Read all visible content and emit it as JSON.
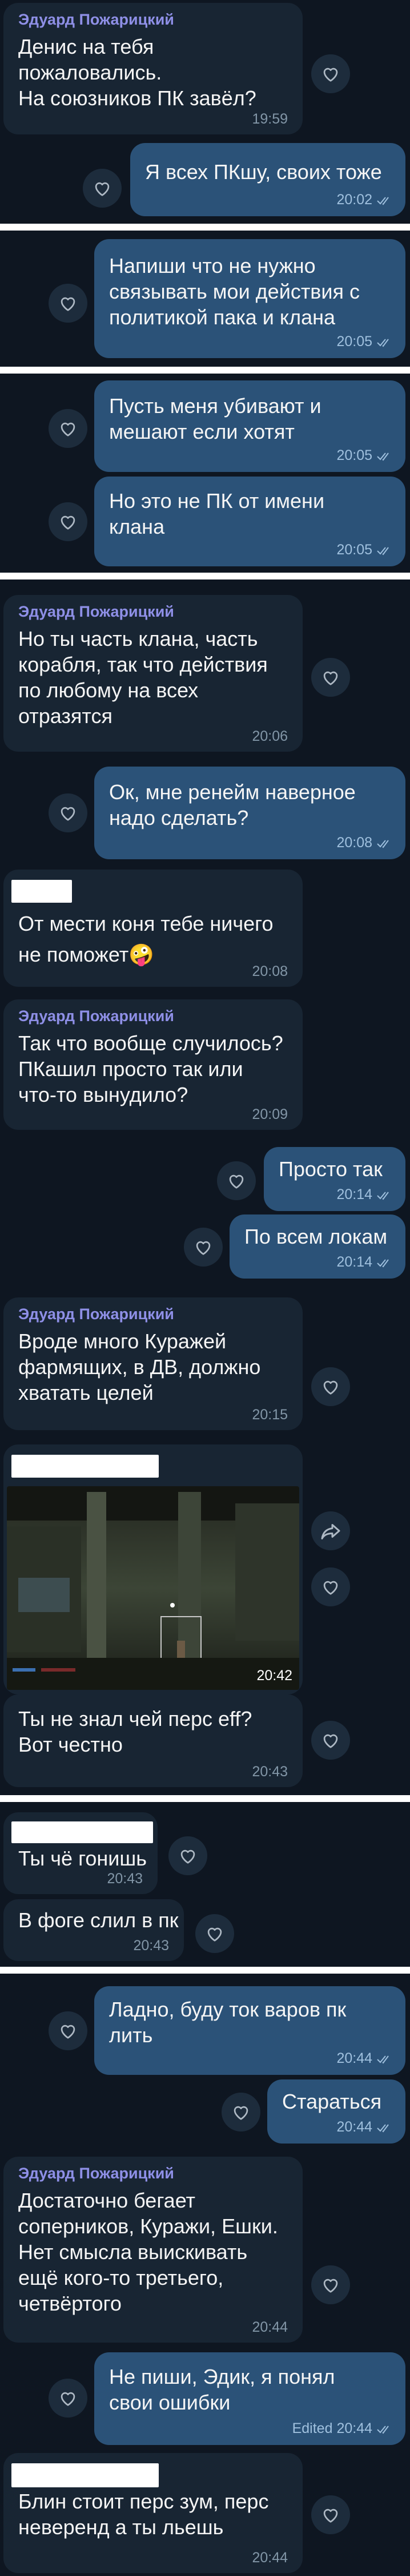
{
  "theme": {
    "background": "#0e1621",
    "incoming": "#182533",
    "outgoing": "#2b5278",
    "sender": "#8e8fe6",
    "separator": "#ffffff"
  },
  "messages": [
    {
      "sender": "Эдуард Пожарицкий",
      "text": "Денис на тебя\nпожаловались.\nНа союзников ПК завёл?",
      "time": "19:59"
    },
    {
      "text": "Я всех ПКшу, своих тоже",
      "time": "20:02"
    },
    {
      "text": "Напиши что не нужно\nсвязывать мои действия с\nполитикой пака и клана",
      "time": "20:05"
    },
    {
      "text": "Пусть меня убивают и\nмешают если хотят",
      "time": "20:05"
    },
    {
      "text": "Но это не ПК от имени\nклана",
      "time": "20:05"
    },
    {
      "sender": "Эдуард Пожарицкий",
      "text": "Но ты часть клана, часть\nкорабля, так что действия\nпо любому на всех\nотразятся",
      "time": "20:06"
    },
    {
      "text": "Ок, мне ренейм наверное\nнадо сделать?",
      "time": "20:08"
    },
    {
      "text": "От мести коня тебе ничего\nне поможет",
      "emoji": "🤪",
      "time": "20:08"
    },
    {
      "sender": "Эдуард Пожарицкий",
      "text": "Так что вообще случилось?\nПКашил просто так или\nчто-то вынудило?",
      "time": "20:09"
    },
    {
      "text": "Просто так",
      "time": "20:14"
    },
    {
      "text": "По всем локам",
      "time": "20:14"
    },
    {
      "sender": "Эдуард Пожарицкий",
      "text": "Вроде много Куражей\nфармящих, в ДВ, должно\nхватать целей",
      "time": "20:15"
    },
    {
      "time": "20:42",
      "media": "game-screenshot"
    },
    {
      "text": "Ты не знал чей перс eff?\nВот честно",
      "time": "20:43"
    },
    {
      "text": "Ты чё гонишь",
      "time": "20:43"
    },
    {
      "text": "В фоге слил в пк",
      "time": "20:43"
    },
    {
      "text": "Ладно, буду ток варов пк\nлить",
      "time": "20:44"
    },
    {
      "text": "Стараться",
      "time": "20:44"
    },
    {
      "sender": "Эдуард Пожарицкий",
      "text": "Достаточно бегает\nсоперников, Куражи, Ешки.\nНет смысла выискивать\nещё кого-то третьего,\nчетвёртого",
      "time": "20:44"
    },
    {
      "text": "Не пиши, Эдик, я понял\nсвои ошибки",
      "time": "20:44",
      "edited": "Edited"
    },
    {
      "text": "Блин стоит перс зум, перс\nневеренд а ты льешь",
      "time": "20:44"
    }
  ]
}
